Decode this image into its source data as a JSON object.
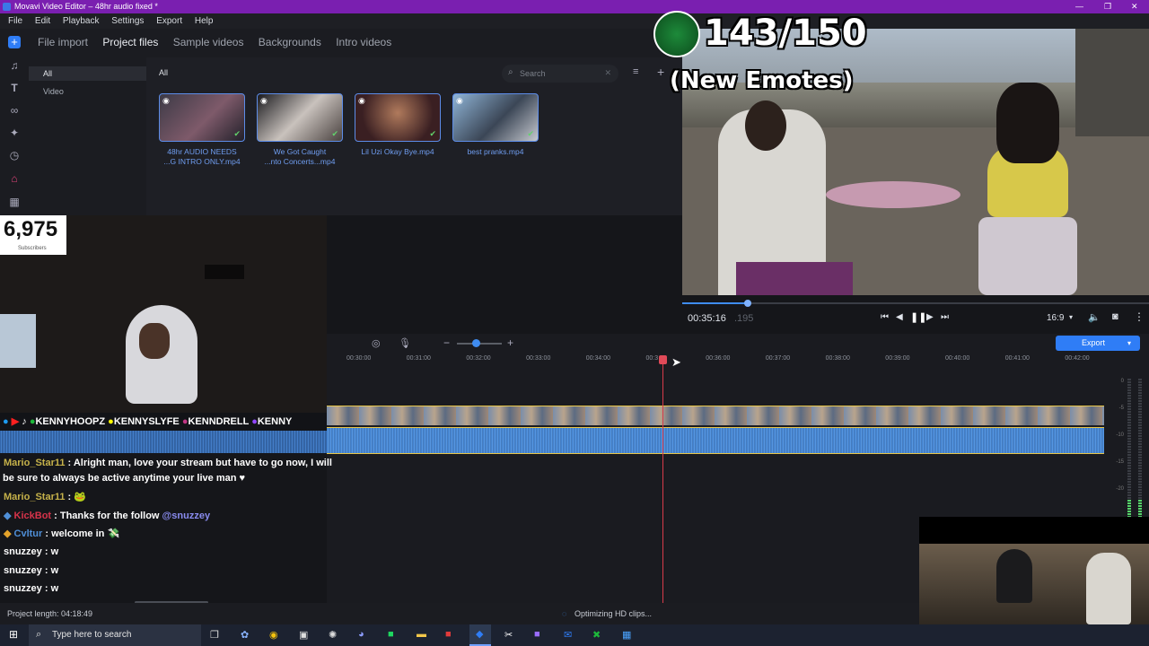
{
  "window": {
    "title": "Movavi Video Editor – 48hr audio fixed *"
  },
  "menu": [
    "File",
    "Edit",
    "Playback",
    "Settings",
    "Export",
    "Help"
  ],
  "topnav": {
    "tabs": [
      "File import",
      "Project files",
      "Sample videos",
      "Backgrounds",
      "Intro videos"
    ],
    "active": "Project files"
  },
  "filter": {
    "items": [
      "All",
      "Video"
    ],
    "header": "All"
  },
  "search": {
    "placeholder": "Search"
  },
  "media": [
    {
      "caption_line1": "48hr AUDIO NEEDS",
      "caption_line2": "...G INTRO ONLY.mp4"
    },
    {
      "caption_line1": "We Got Caught",
      "caption_line2": "...nto Concerts...mp4"
    },
    {
      "caption_line1": "Lil Uzi Okay Bye.mp4",
      "caption_line2": ""
    },
    {
      "caption_line1": "best pranks.mp4",
      "caption_line2": ""
    }
  ],
  "overlay": {
    "counter": "143/150",
    "emotes": "(New Emotes)"
  },
  "subs": {
    "count": "6,975",
    "label": "Subscribers"
  },
  "player": {
    "time": "00:35:16",
    "frames": ".195",
    "aspect": "16:9",
    "progress": 0.14
  },
  "export": {
    "label": "Export"
  },
  "ruler": [
    "00:30:00",
    "00:31:00",
    "00:32:00",
    "00:33:00",
    "00:34:00",
    "00:3",
    "00:36:00",
    "00:37:00",
    "00:38:00",
    "00:39:00",
    "00:40:00",
    "00:41:00",
    "00:42:00"
  ],
  "meter_labels": [
    "0",
    "-5",
    "-10",
    "-15",
    "-20",
    "-25"
  ],
  "social": [
    {
      "icon": "twitter-icon",
      "name": ""
    },
    {
      "icon": "youtube-icon",
      "name": ""
    },
    {
      "icon": "tiktok-icon",
      "name": ""
    },
    {
      "icon": "xbox-icon",
      "name": "KENNYHOOPZ"
    },
    {
      "icon": "snapchat-icon",
      "name": "KENNYSLYFE"
    },
    {
      "icon": "instagram-icon",
      "name": "KENNDRELL"
    },
    {
      "icon": "twitch-icon",
      "name": "KENNY"
    }
  ],
  "chat": [
    {
      "user": "Mario_Star11",
      "user_color": "#c6b24a",
      "text": " : Alright man, love your stream but have to go now, I will",
      "text2": "be sure to always be active anytime your live man ♥"
    },
    {
      "user": "Mario_Star11",
      "user_color": "#c6b24a",
      "text": " : 🐸",
      "text2": ""
    },
    {
      "user": "KickBot",
      "user_color": "#d8334a",
      "text": " : Thanks for the follow ",
      "mention": "@snuzzey",
      "text2": ""
    },
    {
      "user": "Cvltur",
      "user_color": "#4f8fd8",
      "text": " : welcome in 💸",
      "text2": ""
    },
    {
      "user": "snuzzey",
      "user_color": "#e6e6e6",
      "text": " : w",
      "text2": ""
    },
    {
      "user": "snuzzey",
      "user_color": "#e6e6e6",
      "text": " : w",
      "text2": ""
    },
    {
      "user": "snuzzey",
      "user_color": "#e6e6e6",
      "text": " : w",
      "text2": ""
    }
  ],
  "status": {
    "project_length": "Project length: 04:18:49",
    "task": "Optimizing HD clips..."
  },
  "taskbar": {
    "search_placeholder": "Type here to search"
  }
}
